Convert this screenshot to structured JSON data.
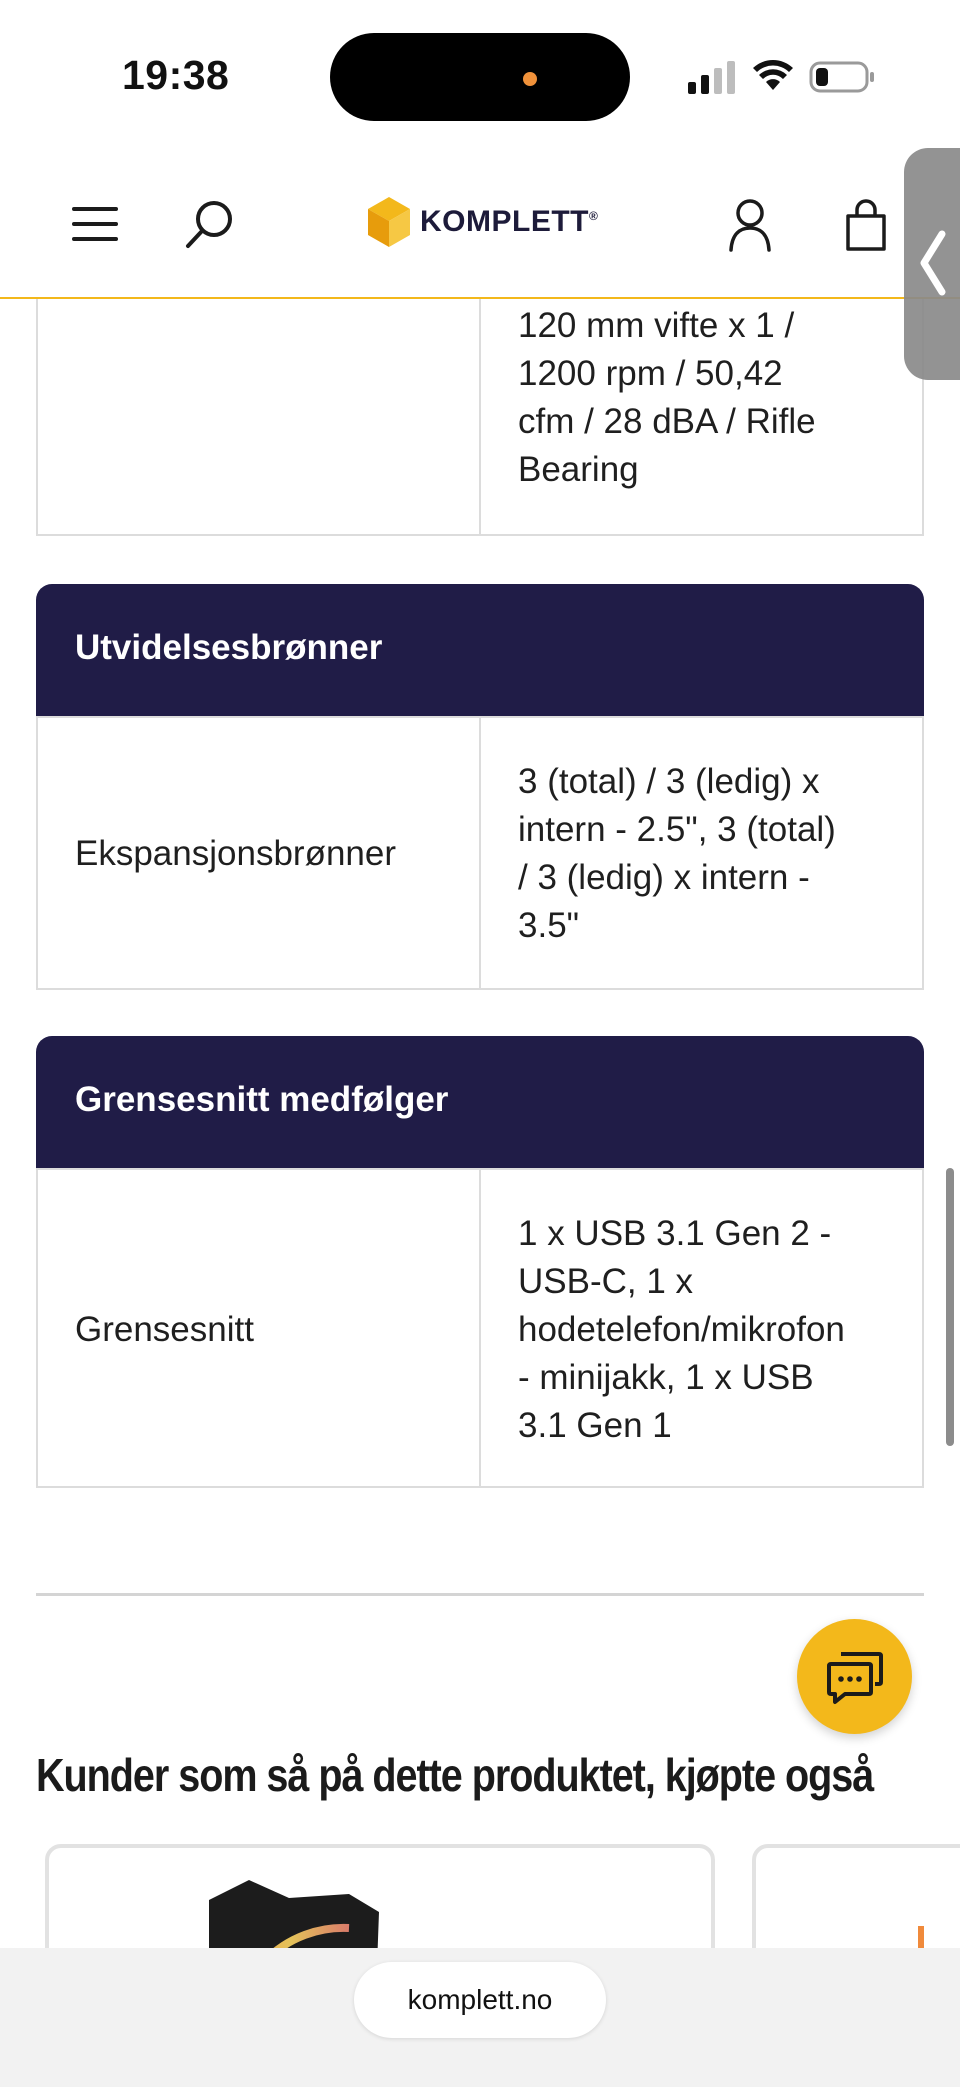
{
  "status_bar": {
    "time": "19:38"
  },
  "header": {
    "brand": "KOMPLETT",
    "brand_mark": "®",
    "accent_color": "#f3b81b",
    "brand_color": "#201c47"
  },
  "specs": {
    "fan_row": {
      "value": [
        "120 mm vifte x 1 /",
        "1200 rpm / 50,42",
        "cfm / 28 dBA / Rifle",
        "Bearing"
      ]
    },
    "sections": [
      {
        "title": "Utvidelsesbrønner",
        "rows": [
          {
            "label": "Ekspansjonsbrønner",
            "value": [
              "3 (total) / 3 (ledig) x",
              "intern - 2.5\", 3 (total)",
              "/ 3 (ledig) x intern -",
              "3.5\""
            ]
          }
        ]
      },
      {
        "title": "Grensesnitt medfølger",
        "rows": [
          {
            "label": "Grensesnitt",
            "value": [
              "1 x USB 3.1 Gen 2 -",
              "USB-C, 1 x",
              "hodetelefon/mikrofon",
              "- minijakk, 1 x USB",
              "3.1 Gen 1"
            ]
          }
        ]
      }
    ]
  },
  "recommendations": {
    "heading": "Kunder som så på dette produktet, kjøpte også"
  },
  "browser": {
    "url": "komplett.no"
  },
  "icons": {
    "menu": "menu-icon",
    "search": "search-icon",
    "account": "account-icon",
    "cart": "cart-icon",
    "chat": "chat-icon",
    "side_tab": "chevron-left-icon"
  }
}
